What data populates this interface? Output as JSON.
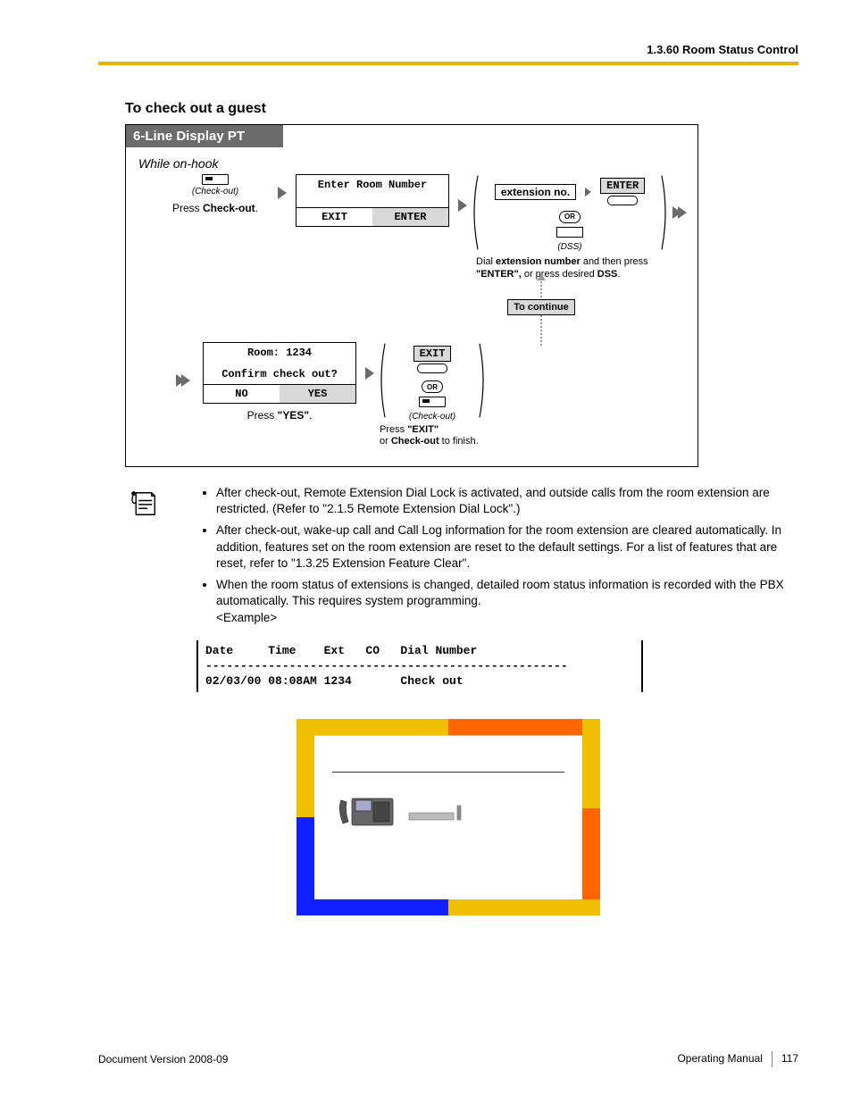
{
  "header": {
    "title": "1.3.60 Room Status Control"
  },
  "section": {
    "title": "To check out a guest",
    "diagram_title": "6-Line Display PT",
    "while_on_hook": "While on-hook"
  },
  "step1": {
    "btn_label": "(Check-out)",
    "caption_a": "Press ",
    "caption_b": "Check-out",
    "caption_c": "."
  },
  "lcd1": {
    "title": "Enter Room Number",
    "left": "EXIT",
    "right": "ENTER"
  },
  "ext_group": {
    "ext_label": "extension no.",
    "enter_label": "ENTER",
    "dss_label": "(DSS)",
    "desc_a": "Dial ",
    "desc_b": "extension number",
    "desc_c": " and then press ",
    "desc_d": "\"ENTER\",",
    "desc_e": " or press desired ",
    "desc_f": "DSS",
    "desc_g": "."
  },
  "or_label": "OR",
  "to_continue": "To continue",
  "lcd2": {
    "room": "Room: 1234",
    "confirm": "Confirm check out?",
    "no": "NO",
    "yes": "YES"
  },
  "press_yes_a": "Press ",
  "press_yes_b": "\"YES\"",
  "press_yes_c": ".",
  "exit_group": {
    "exit_label": "EXIT",
    "checkout_label": "(Check-out)",
    "desc_a": "Press ",
    "desc_b": "\"EXIT\"",
    "desc_c": "or ",
    "desc_d": "Check-out",
    "desc_e": " to finish."
  },
  "notes": {
    "n1": "After check-out, Remote Extension Dial Lock is activated, and outside calls from the room extension are restricted. (Refer to \"2.1.5  Remote Extension Dial Lock\".)",
    "n2": "After check-out, wake-up call and Call Log information for the room extension are cleared automatically. In addition, features set on the room extension are reset to the default settings. For a list of features that are reset, refer to \"1.3.25  Extension Feature Clear\".",
    "n3": "When the room status of extensions is changed, detailed room status information is recorded with the PBX automatically. This requires system programming.",
    "example_label": "<Example>"
  },
  "example_table": {
    "header": "Date     Time    Ext   CO   Dial Number",
    "divider": "----------------------------------------------------",
    "row": "02/03/00 08:08AM 1234       Check out"
  },
  "footer": {
    "left_a": "Document Version  ",
    "left_b": "2008-09",
    "right_a": "Operating Manual",
    "page_no": "117"
  }
}
